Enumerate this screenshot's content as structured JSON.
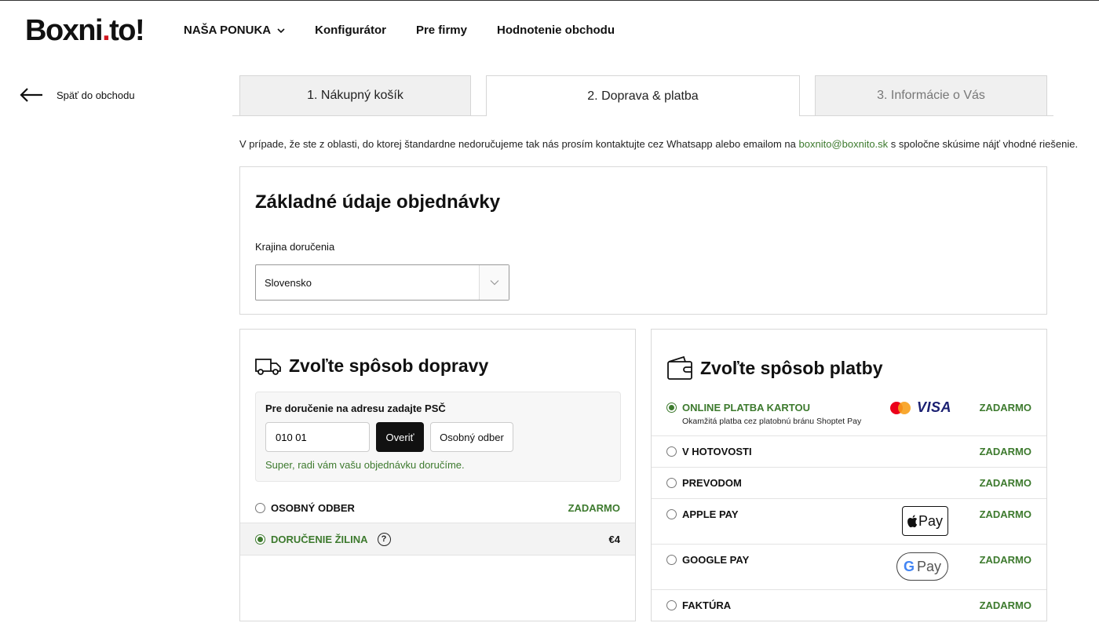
{
  "header": {
    "logo_main": "Boxni",
    "logo_dot": ".",
    "logo_end": "to!",
    "nav": [
      "NAŠA PONUKA",
      "Konfigurátor",
      "Pre firmy",
      "Hodnotenie obchodu"
    ]
  },
  "back_label": "Späť do obchodu",
  "tabs": [
    "1. Nákupný košík",
    "2. Doprava & platba",
    "3. Informácie o Vás"
  ],
  "info": {
    "before": "V prípade, že ste z oblasti, do ktorej štandardne nedoručujeme tak nás prosím kontaktujte cez Whatsapp alebo emailom na ",
    "email": "boxnito@boxnito.sk",
    "after": " s spoločne skúsime nájť vhodné riešenie."
  },
  "basic": {
    "title": "Základné údaje objednávky",
    "country_label": "Krajina doručenia",
    "country_value": "Slovensko"
  },
  "shipping": {
    "title": "Zvoľte spôsob dopravy",
    "psc_label": "Pre doručenie na adresu zadajte PSČ",
    "psc_value": "010 01",
    "verify_label": "Overiť",
    "pickup_button": "Osobný odber",
    "success": "Super, radi vám vašu objednávku doručíme.",
    "options": [
      {
        "name": "OSOBNÝ ODBER",
        "price": "ZADARMO"
      },
      {
        "name": "DORUČENIE ŽILINA",
        "price": "€4",
        "help": "?"
      }
    ]
  },
  "payment": {
    "title": "Zvoľte spôsob platby",
    "card_brand": "VISA",
    "apple_pay_badge": "Pay",
    "google_pay_g": "G",
    "google_pay_badge": "Pay",
    "options": [
      {
        "name": "ONLINE PLATBA KARTOU",
        "sub": "Okamžitá platba cez platobnú bránu Shoptet Pay",
        "price": "ZADARMO"
      },
      {
        "name": "V HOTOVOSTI",
        "price": "ZADARMO"
      },
      {
        "name": "PREVODOM",
        "price": "ZADARMO"
      },
      {
        "name": "APPLE PAY",
        "price": "ZADARMO"
      },
      {
        "name": "GOOGLE PAY",
        "price": "ZADARMO"
      },
      {
        "name": "FAKTÚRA",
        "price": "ZADARMO"
      }
    ]
  },
  "colors": {
    "accent_green": "#3d7a2e",
    "logo_red": "#d0161e"
  }
}
